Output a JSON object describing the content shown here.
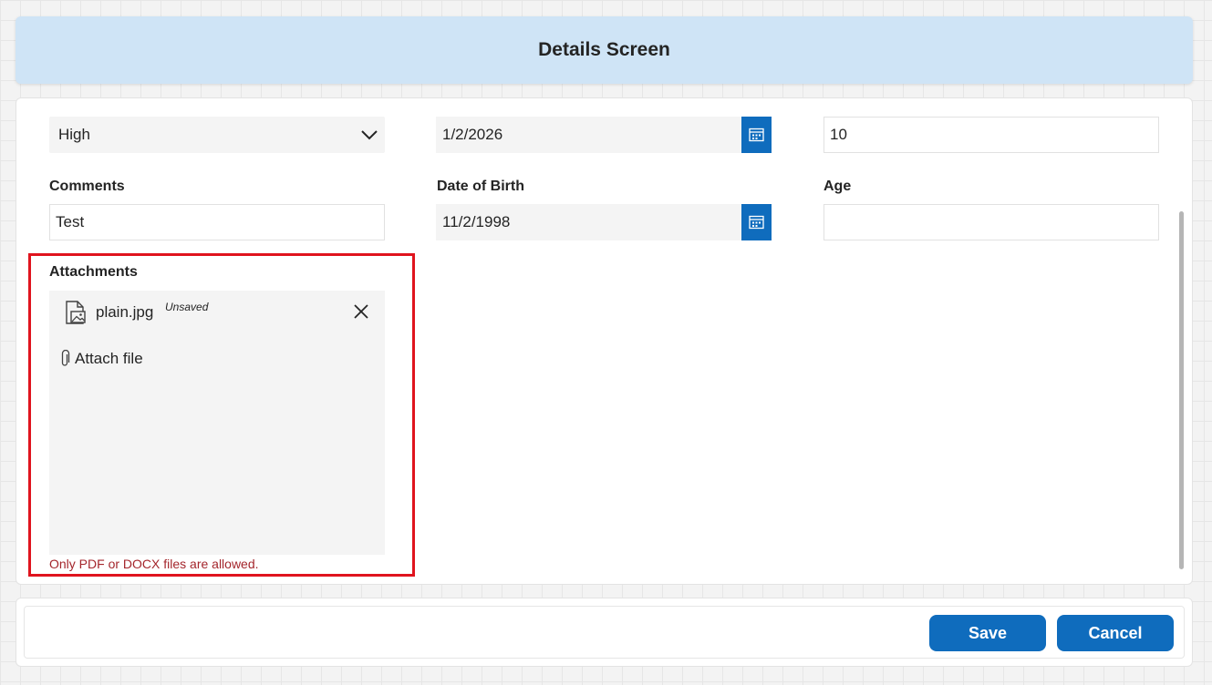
{
  "header": {
    "title": "Details Screen"
  },
  "form": {
    "row1": {
      "priority_value": "High",
      "date_value": "1/2/2026",
      "number_value": "10"
    },
    "comments": {
      "label": "Comments",
      "value": "Test"
    },
    "date_of_birth": {
      "label": "Date of Birth",
      "value": "11/2/1998"
    },
    "age": {
      "label": "Age",
      "value": ""
    },
    "attachments": {
      "label": "Attachments",
      "files": [
        {
          "name": "plain.jpg",
          "status": "Unsaved",
          "icon": "image-file-icon"
        }
      ],
      "attach_label": "Attach file",
      "error": "Only PDF or DOCX files are allowed."
    }
  },
  "footer": {
    "save_label": "Save",
    "cancel_label": "Cancel"
  },
  "colors": {
    "accent": "#0f6cbd",
    "header_bg": "#cfe4f6",
    "error": "#a4262c",
    "highlight": "#e0141e"
  },
  "icons": [
    "chevron-down-icon",
    "calendar-icon",
    "image-file-icon",
    "close-icon",
    "paperclip-icon"
  ]
}
